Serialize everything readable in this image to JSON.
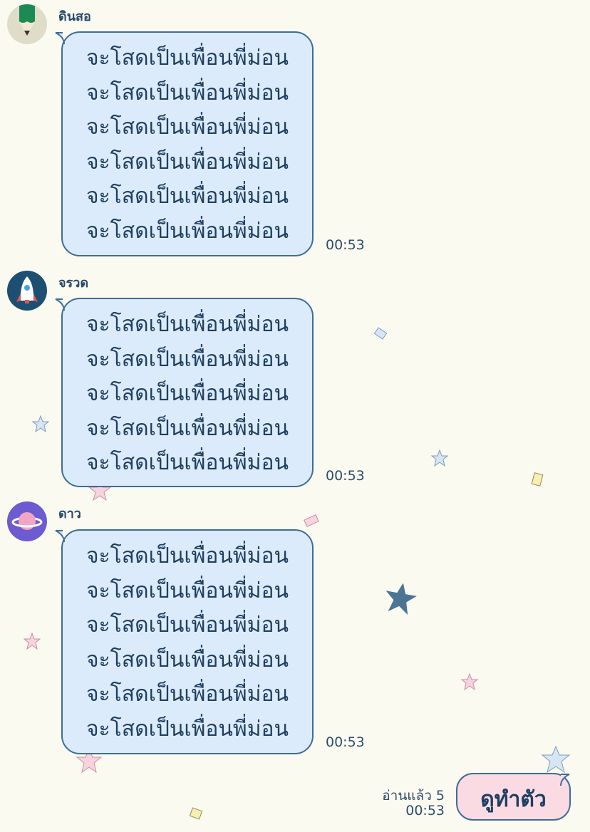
{
  "messages": [
    {
      "sender": "ดินสอ",
      "avatar_icon": "pencil-icon",
      "lines": [
        "จะโสดเป็นเพื่อนพี่ม่อน",
        "จะโสดเป็นเพื่อนพี่ม่อน",
        "จะโสดเป็นเพื่อนพี่ม่อน",
        "จะโสดเป็นเพื่อนพี่ม่อน",
        "จะโสดเป็นเพื่อนพี่ม่อน",
        "จะโสดเป็นเพื่อนพี่ม่อน"
      ],
      "time": "00:53"
    },
    {
      "sender": "จรวด",
      "avatar_icon": "rocket-icon",
      "lines": [
        "จะโสดเป็นเพื่อนพี่ม่อน",
        "จะโสดเป็นเพื่อนพี่ม่อน",
        "จะโสดเป็นเพื่อนพี่ม่อน",
        "จะโสดเป็นเพื่อนพี่ม่อน",
        "จะโสดเป็นเพื่อนพี่ม่อน"
      ],
      "time": "00:53"
    },
    {
      "sender": "ดาว",
      "avatar_icon": "planet-icon",
      "lines": [
        "จะโสดเป็นเพื่อนพี่ม่อน",
        "จะโสดเป็นเพื่อนพี่ม่อน",
        "จะโสดเป็นเพื่อนพี่ม่อน",
        "จะโสดเป็นเพื่อนพี่ม่อน",
        "จะโสดเป็นเพื่อนพี่ม่อน",
        "จะโสดเป็นเพื่อนพี่ม่อน"
      ],
      "time": "00:53"
    }
  ],
  "sent_message": {
    "text": "ดูทำตัว",
    "read_status": "อ่านแล้ว 5",
    "time": "00:53"
  },
  "colors": {
    "background": "#fbfaf0",
    "received_bubble": "#dcebfb",
    "sent_bubble": "#fadbe4",
    "bubble_border": "#3d6d97",
    "text": "#1f3f60"
  }
}
